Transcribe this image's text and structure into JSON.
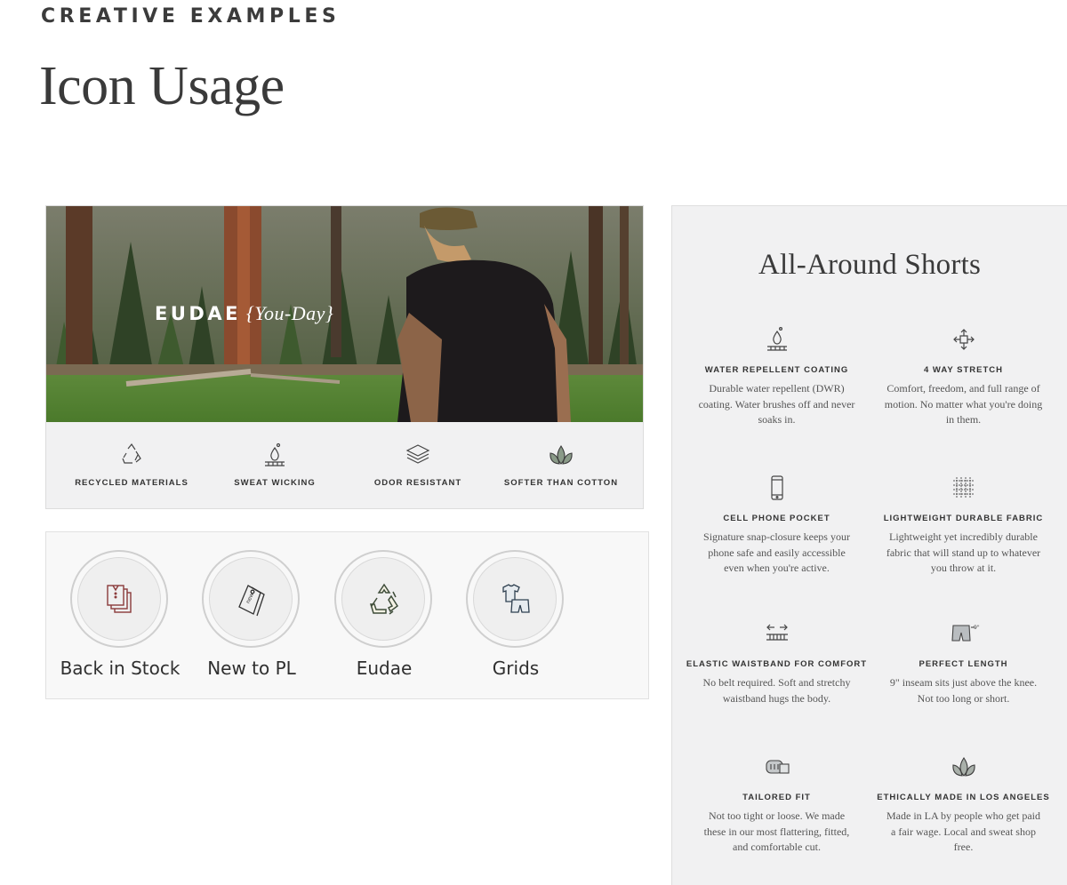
{
  "header": {
    "eyebrow": "CREATIVE EXAMPLES",
    "title": "Icon Usage"
  },
  "banner": {
    "brand": "EUDAE",
    "brand_tagline": "{You-Day}",
    "features": [
      {
        "label": "RECYCLED MATERIALS",
        "icon": "recycle-icon"
      },
      {
        "label": "SWEAT WICKING",
        "icon": "droplet-icon"
      },
      {
        "label": "ODOR RESISTANT",
        "icon": "layers-icon"
      },
      {
        "label": "SOFTER THAN COTTON",
        "icon": "leaf-icon"
      }
    ]
  },
  "categories": [
    {
      "label": "Back in Stock",
      "icon": "shirt-stack-icon"
    },
    {
      "label": "New to PL",
      "icon": "new-tag-icon"
    },
    {
      "label": "Eudae",
      "icon": "recycle-icon"
    },
    {
      "label": "Grids",
      "icon": "tshirt-shorts-icon"
    }
  ],
  "product": {
    "title": "All-Around Shorts",
    "specs": [
      {
        "title": "WATER REPELLENT COATING",
        "desc": "Durable water repellent (DWR) coating. Water brushes off and never soaks in.",
        "icon": "water-drop-icon"
      },
      {
        "title": "4 WAY STRETCH",
        "desc": "Comfort, freedom, and full range of motion. No matter what you're doing in them.",
        "icon": "four-way-arrows-icon"
      },
      {
        "title": "CELL PHONE POCKET",
        "desc": "Signature snap-closure keeps your phone safe and easily accessible even when you're active.",
        "icon": "phone-icon"
      },
      {
        "title": "LIGHTWEIGHT DURABLE FABRIC",
        "desc": "Lightweight yet incredibly durable fabric that will stand up to whatever you throw at it.",
        "icon": "fabric-weave-icon"
      },
      {
        "title": "ELASTIC WAISTBAND FOR COMFORT",
        "desc": "No belt required. Soft and stretchy waistband hugs the body.",
        "icon": "waistband-icon"
      },
      {
        "title": "PERFECT LENGTH",
        "desc": "9\" inseam sits just above the knee. Not too long or short.",
        "icon": "shorts-length-icon",
        "icon_label": "9\""
      },
      {
        "title": "TAILORED FIT",
        "desc": "Not too tight or loose. We made these in our most flattering, fitted, and comfortable cut.",
        "icon": "tape-measure-icon"
      },
      {
        "title": "ETHICALLY MADE IN LOS ANGELES",
        "desc": "Made in LA by people who get paid a fair wage. Local and sweat shop free.",
        "icon": "leaf-icon"
      }
    ]
  }
}
